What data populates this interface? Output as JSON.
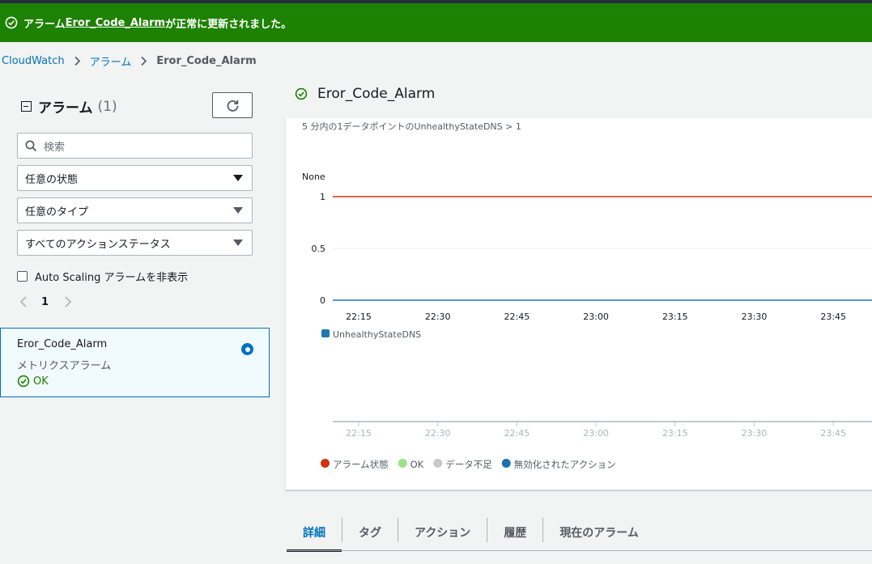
{
  "flash": {
    "prefix": "アラーム",
    "alarm_link": "Eror_Code_Alarm",
    "suffix": "が正常に更新されました。",
    "bg_color": "#1d8102"
  },
  "breadcrumb": {
    "items": [
      "CloudWatch",
      "アラーム",
      "Eror_Code_Alarm"
    ]
  },
  "left": {
    "title": "アラーム",
    "count": "(1)",
    "search_placeholder": "検索",
    "filters": [
      "任意の状態",
      "任意のタイプ",
      "すべてのアクションステータス"
    ],
    "hide_autoscaling_label": "Auto Scaling アラームを非表示",
    "page": "1",
    "alarm": {
      "name": "Eror_Code_Alarm",
      "type": "メトリクスアラーム",
      "state": "OK"
    }
  },
  "detail": {
    "title": "Eror_Code_Alarm",
    "condition": "5 分内の1データポイントのUnhealthyStateDNS > 1",
    "tabs": [
      "詳細",
      "タグ",
      "アクション",
      "履歴",
      "現在のアラーム"
    ],
    "active_tab": "詳細"
  },
  "chart_data": [
    {
      "type": "line",
      "ylabel": "None",
      "y_ticks": [
        "1",
        "0.5",
        "0"
      ],
      "ylim": [
        0,
        1
      ],
      "x_ticks": [
        "22:15",
        "22:30",
        "22:45",
        "23:00",
        "23:15",
        "23:30",
        "23:45"
      ],
      "threshold": 1,
      "threshold_color": "#d13212",
      "series": [
        {
          "name": "UnhealthyStateDNS",
          "color": "#1f77b4",
          "values": [
            0,
            0,
            0,
            0,
            0,
            0,
            0
          ]
        }
      ],
      "grid": true
    },
    {
      "type": "timeline",
      "x_ticks": [
        "22:15",
        "22:30",
        "22:45",
        "23:00",
        "23:15",
        "23:30",
        "23:45"
      ],
      "legend": [
        {
          "label": "アラーム状態",
          "color": "#d13212"
        },
        {
          "label": "OK",
          "color": "#9be38a"
        },
        {
          "label": "データ不足",
          "color": "#c8c8c8"
        },
        {
          "label": "無効化されたアクション",
          "color": "#1f6fb4"
        }
      ]
    }
  ]
}
